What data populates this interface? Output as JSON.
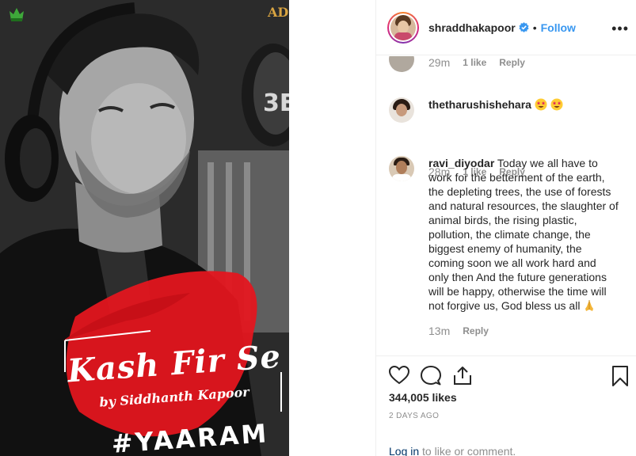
{
  "media": {
    "title": "Kash Fir Se",
    "byline": "by Siddhanth Kapoor",
    "hashtag": "#YAARAM",
    "corner_logo_left": "",
    "corner_logo_right": "AD"
  },
  "header": {
    "username": "shraddhakapoor",
    "separator": "•",
    "follow_label": "Follow",
    "more_label": "•••"
  },
  "comments": [
    {
      "time": "29m",
      "likes": "1 like",
      "reply": "Reply"
    },
    {
      "user": "thetharushishehara",
      "text": "",
      "time": "28m",
      "likes": "1 like",
      "reply": "Reply"
    },
    {
      "user": "ravi_diyodar",
      "lines": [
        "Today we all have to",
        "work for the betterment of the earth,",
        "the depleting trees, the use of forests",
        "and natural resources, the slaughter of",
        "animal birds, the rising plastic,",
        "pollution, the climate change, the",
        "biggest enemy of humanity, the",
        "coming soon we all work hard and",
        "only then And the future generations",
        "will be happy, otherwise the time will",
        "not forgive us, God bless us all"
      ],
      "time": "13m",
      "reply": "Reply"
    }
  ],
  "actions": {
    "likes_count": "344,005 likes",
    "date": "2 DAYS AGO",
    "login_link": "Log in",
    "login_rest": " to like or comment."
  },
  "colors": {
    "accent": "#3897f0",
    "brush_red": "#e3161f",
    "text": "#262626",
    "muted": "#8e8e8e"
  }
}
